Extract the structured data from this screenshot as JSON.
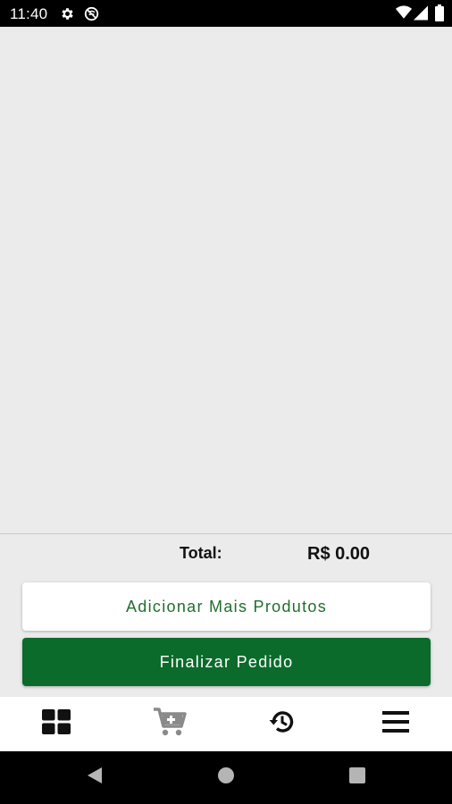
{
  "status_bar": {
    "time": "11:40",
    "icons_left": [
      "gear-icon",
      "do-not-disturb-icon"
    ],
    "icons_right": [
      "wifi-icon",
      "signal-icon",
      "battery-icon"
    ]
  },
  "summary": {
    "total_label": "Total:",
    "total_value": "R$ 0.00"
  },
  "buttons": {
    "add_more_label": "Adicionar Mais Produtos",
    "finish_label": "Finalizar Pedido"
  },
  "bottom_nav": {
    "items": [
      {
        "icon": "grid-icon"
      },
      {
        "icon": "cart-add-icon"
      },
      {
        "icon": "history-icon"
      },
      {
        "icon": "menu-icon"
      }
    ]
  },
  "system_nav": {
    "buttons": [
      "back-icon",
      "home-icon",
      "recents-icon"
    ]
  },
  "colors": {
    "primary_green": "#0a6b2b",
    "text_green": "#1f6e2d",
    "background": "#ebebeb"
  }
}
